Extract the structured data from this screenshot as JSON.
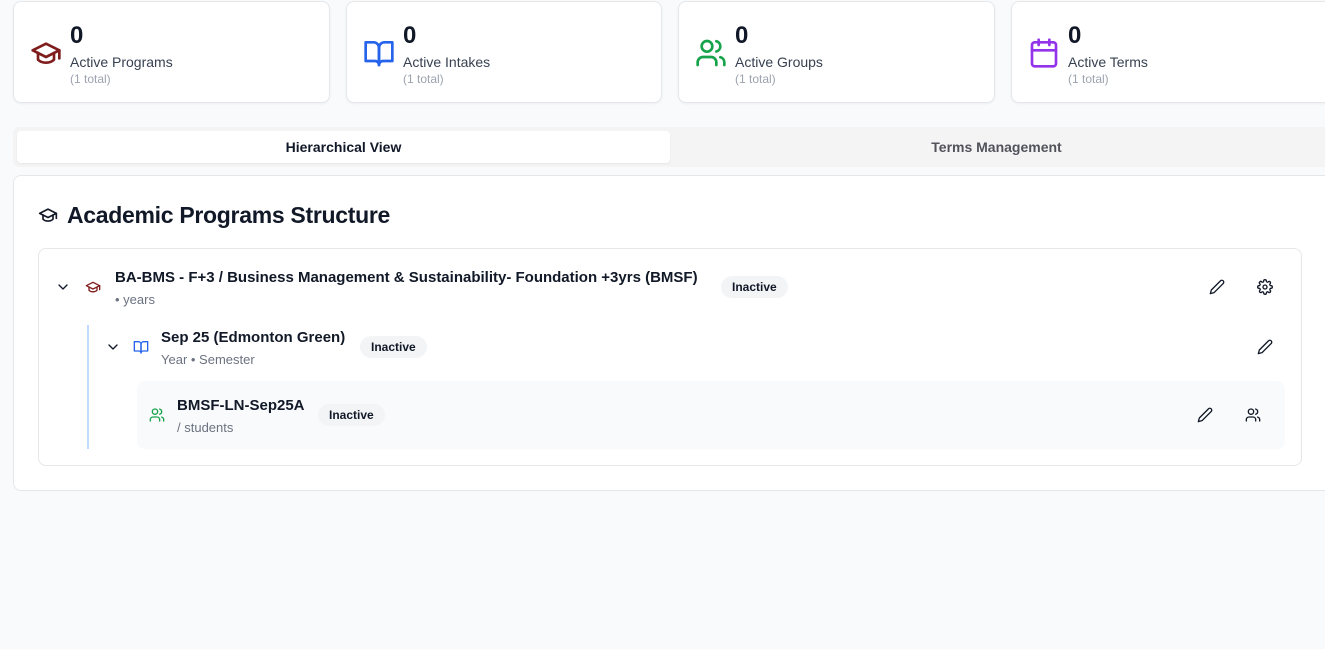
{
  "stats": [
    {
      "count": "0",
      "label": "Active Programs",
      "sub": "(1 total)",
      "icon": "graduation-cap-icon",
      "color": "#7f1d1d"
    },
    {
      "count": "0",
      "label": "Active Intakes",
      "sub": "(1 total)",
      "icon": "book-open-icon",
      "color": "#2563eb"
    },
    {
      "count": "0",
      "label": "Active Groups",
      "sub": "(1 total)",
      "icon": "users-icon",
      "color": "#16a34a"
    },
    {
      "count": "0",
      "label": "Active Terms",
      "sub": "(1 total)",
      "icon": "calendar-icon",
      "color": "#9333ea"
    }
  ],
  "tabs": [
    {
      "label": "Hierarchical View",
      "active": true
    },
    {
      "label": "Terms Management",
      "active": false
    }
  ],
  "panel": {
    "title": "Academic Programs Structure",
    "icon": "graduation-cap-icon"
  },
  "program": {
    "title": "BA-BMS - F+3 / Business Management & Sustainability- Foundation +3yrs (BMSF)",
    "subtitle": "• years",
    "status": "Inactive",
    "icon": "graduation-cap-icon",
    "actions": [
      "pencil-icon",
      "gear-icon"
    ]
  },
  "intake": {
    "title": "Sep 25 (Edmonton Green)",
    "subtitle": "Year • Semester",
    "status": "Inactive",
    "icon": "book-open-icon",
    "actions": [
      "pencil-icon"
    ]
  },
  "group": {
    "title": "BMSF-LN-Sep25A",
    "subtitle": "/ students",
    "status": "Inactive",
    "icon": "users-icon",
    "actions": [
      "pencil-icon",
      "users-icon"
    ]
  },
  "colors": {
    "program_icon": "#7f1d1d",
    "intake_icon": "#2563eb",
    "group_icon": "#16a34a",
    "term_icon": "#9333ea",
    "intake_line": "#bfdbfe"
  }
}
